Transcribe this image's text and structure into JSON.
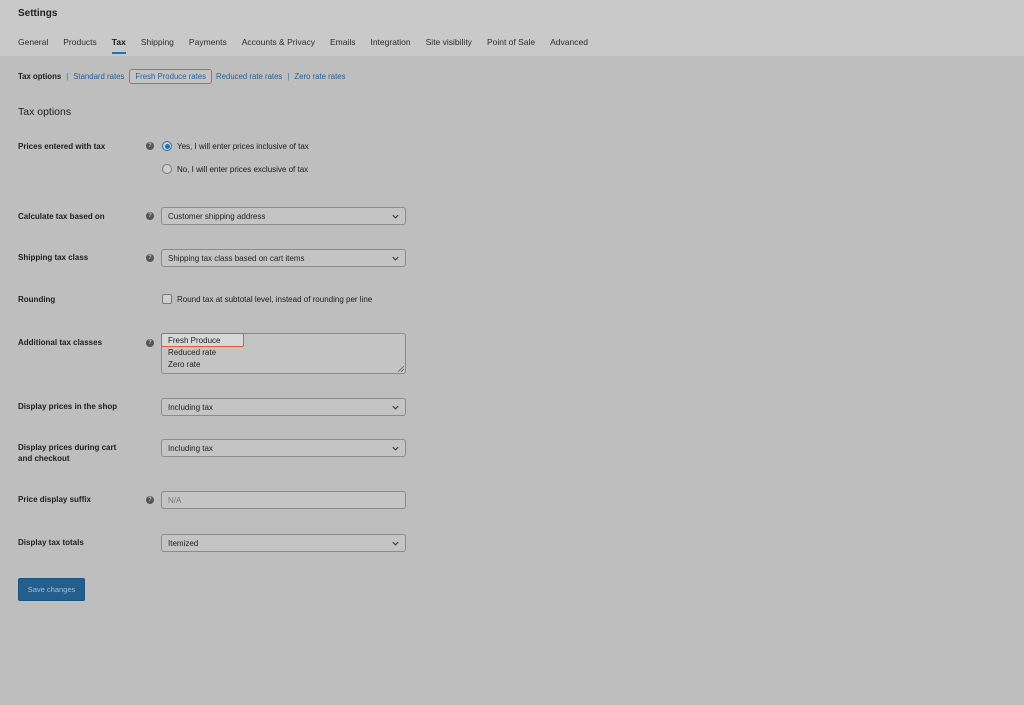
{
  "header": {
    "title": "Settings",
    "tabs": [
      {
        "label": "General"
      },
      {
        "label": "Products"
      },
      {
        "label": "Tax"
      },
      {
        "label": "Shipping"
      },
      {
        "label": "Payments"
      },
      {
        "label": "Accounts & Privacy"
      },
      {
        "label": "Emails"
      },
      {
        "label": "Integration"
      },
      {
        "label": "Site visibility"
      },
      {
        "label": "Point of Sale"
      },
      {
        "label": "Advanced"
      }
    ],
    "active_tab": "Tax"
  },
  "subnav": {
    "current": "Tax options",
    "links": [
      {
        "label": "Standard rates"
      },
      {
        "label": "Fresh Produce rates"
      },
      {
        "label": "Reduced rate rates"
      },
      {
        "label": "Zero rate rates"
      }
    ],
    "separator": "|"
  },
  "section_title": "Tax options",
  "help_glyph": "?",
  "fields": {
    "prices_entered": {
      "label": "Prices entered with tax",
      "options": [
        {
          "label": "Yes, I will enter prices inclusive of tax",
          "checked": true
        },
        {
          "label": "No, I will enter prices exclusive of tax",
          "checked": false
        }
      ]
    },
    "calc_based_on": {
      "label": "Calculate tax based on",
      "value": "Customer shipping address"
    },
    "shipping_class": {
      "label": "Shipping tax class",
      "value": "Shipping tax class based on cart items"
    },
    "rounding": {
      "label": "Rounding",
      "checkbox_label": "Round tax at subtotal level, instead of rounding per line",
      "checked": false
    },
    "additional_classes": {
      "label": "Additional tax classes",
      "lines": [
        "Fresh Produce",
        "Reduced rate",
        "Zero rate"
      ]
    },
    "display_shop": {
      "label": "Display prices in the shop",
      "value": "Including tax"
    },
    "display_cart": {
      "label_line1": "Display prices during cart",
      "label_line2": "and checkout",
      "value": "Including tax"
    },
    "suffix": {
      "label": "Price display suffix",
      "placeholder": "N/A"
    },
    "tax_totals": {
      "label": "Display tax totals",
      "value": "Itemized"
    }
  },
  "save_button": {
    "label": "Save changes"
  },
  "colors": {
    "accent": "#2271b1",
    "highlight": "#e05c36"
  }
}
